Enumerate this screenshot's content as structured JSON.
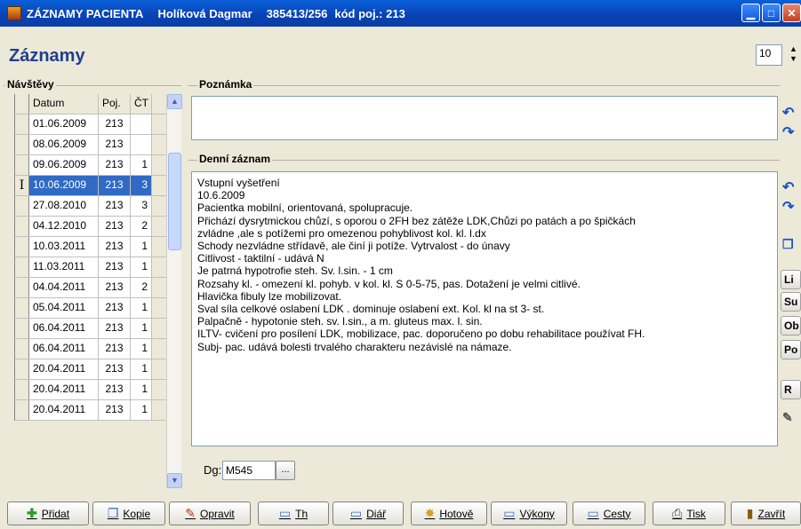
{
  "window": {
    "title_app": "ZÁZNAMY PACIENTA",
    "patient_name": "Holíková Dagmar",
    "patient_id": "385413/256",
    "insurer": "kód poj.: 213"
  },
  "heading": "Záznamy",
  "spinner_value": "10",
  "visits": {
    "label": "Návštěvy",
    "headers": [
      "Datum",
      "Poj.",
      "ČT"
    ],
    "rows": [
      [
        "01.06.2009",
        "213",
        ""
      ],
      [
        "08.06.2009",
        "213",
        ""
      ],
      [
        "09.06.2009",
        "213",
        "1"
      ],
      [
        "10.06.2009",
        "213",
        "3"
      ],
      [
        "27.08.2010",
        "213",
        "3"
      ],
      [
        "04.12.2010",
        "213",
        "2"
      ],
      [
        "10.03.2011",
        "213",
        "1"
      ],
      [
        "11.03.2011",
        "213",
        "1"
      ],
      [
        "04.04.2011",
        "213",
        "2"
      ],
      [
        "05.04.2011",
        "213",
        "1"
      ],
      [
        "06.04.2011",
        "213",
        "1"
      ],
      [
        "06.04.2011",
        "213",
        "1"
      ],
      [
        "20.04.2011",
        "213",
        "1"
      ],
      [
        "20.04.2011",
        "213",
        "1"
      ],
      [
        "20.04.2011",
        "213",
        "1"
      ]
    ],
    "selected_index": 3,
    "selected_marker": "I"
  },
  "note": {
    "label": "Poznámka",
    "text": ""
  },
  "record": {
    "label": "Denní záznam",
    "lines": [
      "Vstupní vyšetření",
      "10.6.2009",
      "Pacientka mobilní, orientovaná, spolupracuje.",
      "Přichází dysrytmickou chůzí, s oporou o 2FH bez zátěže LDK,Chůzi po patách a po špičkách",
      "zvládne ,ale s potížemi pro omezenou pohyblivost kol. kl. l.dx",
      "Schody nezvládne střídavě, ale činí ji potíže. Vytrvalost - do únavy",
      "Citlivost - taktilní - udává N",
      "Je patrná hypotrofie steh. Sv. l.sin. - 1  cm",
      "Rozsahy kl. - omezení kl. pohyb.  v kol. kl. S 0-5-75, pas. Dotažení je velmi citlivé.",
      "Hlavička fibuly lze mobilizovat.",
      "Sval síla celkové oslabení LDK . dominuje oslabení ext. Kol. kl na st 3- st.",
      "Palpačně -  hypotonie steh. sv. l.sin., a m. gluteus max. l. sin.",
      "ILTV- cvičení pro posílení LDK, mobilizace, pac. doporučeno po dobu rehabilitace používat FH.",
      "Subj- pac. udává bolesti trvalého charakteru nezávislé na námaze."
    ]
  },
  "side_buttons": [
    "Li",
    "Su",
    "Ob",
    "Po",
    "R"
  ],
  "diagnosis": {
    "label": "Dg:",
    "value": "M545",
    "button": "..."
  },
  "toolbar": [
    {
      "label": "Přidat",
      "icon": "plus-icon"
    },
    {
      "label": "Kopie",
      "icon": "copy-icon"
    },
    {
      "label": "Opravit",
      "icon": "pencil-icon"
    },
    {
      "label": "Th",
      "icon": "window-icon"
    },
    {
      "label": "Diář",
      "icon": "window-icon"
    },
    {
      "label": "Hotově",
      "icon": "coins-icon"
    },
    {
      "label": "Výkony",
      "icon": "window-icon"
    },
    {
      "label": "Cesty",
      "icon": "window-icon"
    },
    {
      "label": "Tisk",
      "icon": "printer-icon"
    },
    {
      "label": "Zavřít",
      "icon": "door-icon"
    }
  ],
  "colors": {
    "title_bar": "#0842b3",
    "selection": "#316ac5",
    "heading": "#1f3f8f"
  }
}
